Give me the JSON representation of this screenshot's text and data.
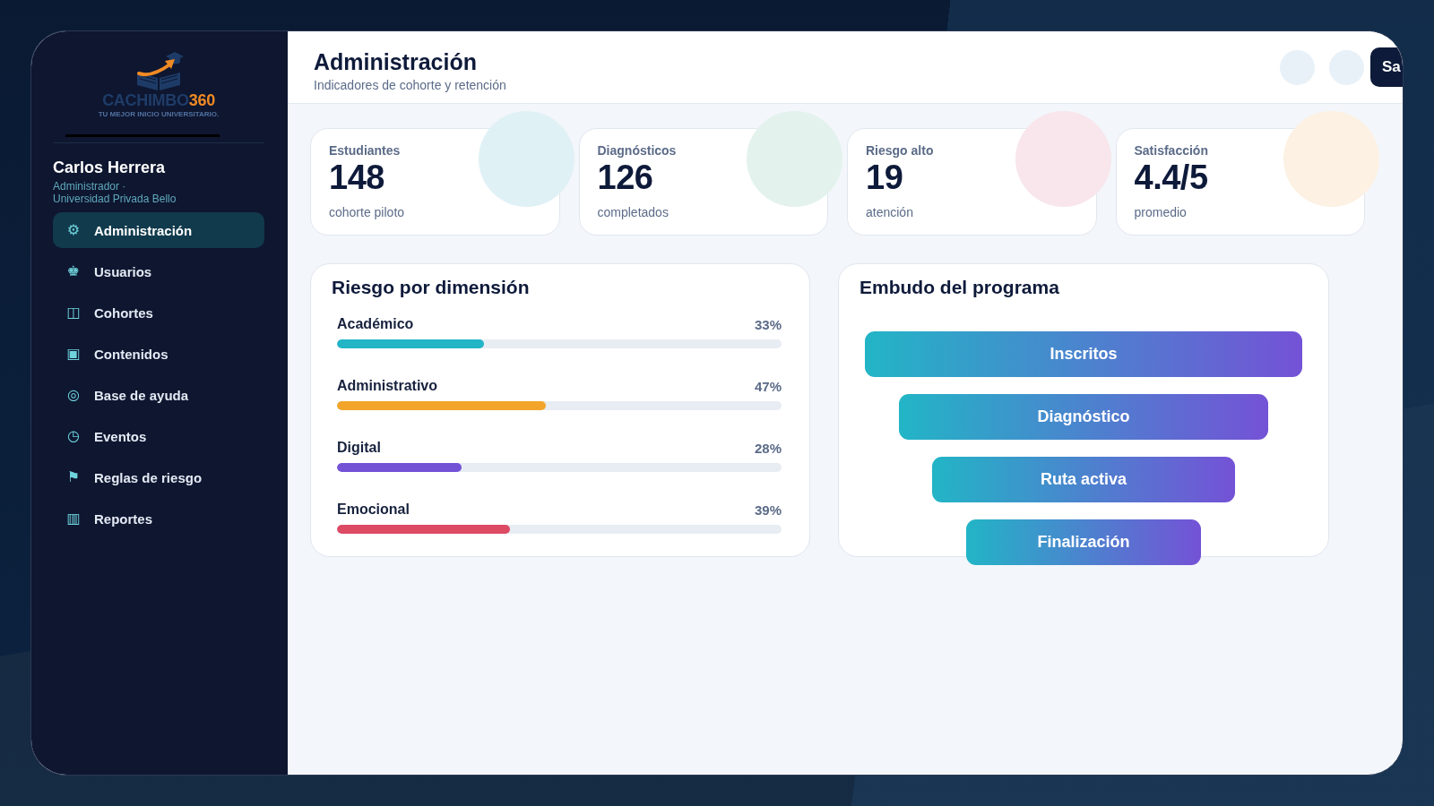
{
  "sidebar": {
    "logo": {
      "wordmark": "CACHIMBO",
      "wordmark_accent": "360",
      "tagline": "TU MEJOR INICIO UNIVERSITARIO."
    },
    "user": {
      "name": "Carlos Herrera",
      "role": "Administrador · Universidad Privada Bello"
    },
    "nav": [
      {
        "icon": "⚙",
        "label": "Administración",
        "selected": true
      },
      {
        "icon": "♚",
        "label": "Usuarios",
        "selected": false
      },
      {
        "icon": "◫",
        "label": "Cohortes",
        "selected": false
      },
      {
        "icon": "▣",
        "label": "Contenidos",
        "selected": false
      },
      {
        "icon": "◎",
        "label": "Base de ayuda",
        "selected": false
      },
      {
        "icon": "◷",
        "label": "Eventos",
        "selected": false
      },
      {
        "icon": "⚑",
        "label": "Reglas de riesgo",
        "selected": false
      },
      {
        "icon": "▥",
        "label": "Reportes",
        "selected": false
      }
    ]
  },
  "header": {
    "title": "Administración",
    "subtitle": "Indicadores de cohorte y retención",
    "button": "Sa"
  },
  "kpis": [
    {
      "label": "Estudiantes",
      "value": "148",
      "note": "cohorte piloto",
      "color": "#e0f1f6"
    },
    {
      "label": "Diagnósticos",
      "value": "126",
      "note": "completados",
      "color": "#e3f2ec"
    },
    {
      "label": "Riesgo alto",
      "value": "19",
      "note": "atención",
      "color": "#f8e6ec"
    },
    {
      "label": "Satisfacción",
      "value": "4.4/5",
      "note": "promedio",
      "color": "#fcf1e3"
    }
  ],
  "risk_panel": {
    "title": "Riesgo por dimensión",
    "rows": [
      {
        "label": "Académico",
        "reading": "33%",
        "level": 0.33,
        "color": "#22b5c6"
      },
      {
        "label": "Administrativo",
        "reading": "47%",
        "level": 0.47,
        "color": "#f2a52a"
      },
      {
        "label": "Digital",
        "reading": "28%",
        "level": 0.28,
        "color": "#7452d6"
      },
      {
        "label": "Emocional",
        "reading": "39%",
        "level": 0.39,
        "color": "#dc4a64"
      }
    ]
  },
  "funnel_panel": {
    "title": "Embudo del programa",
    "stages": [
      "Inscritos",
      "Diagnóstico",
      "Ruta activa",
      "Finalización"
    ]
  }
}
